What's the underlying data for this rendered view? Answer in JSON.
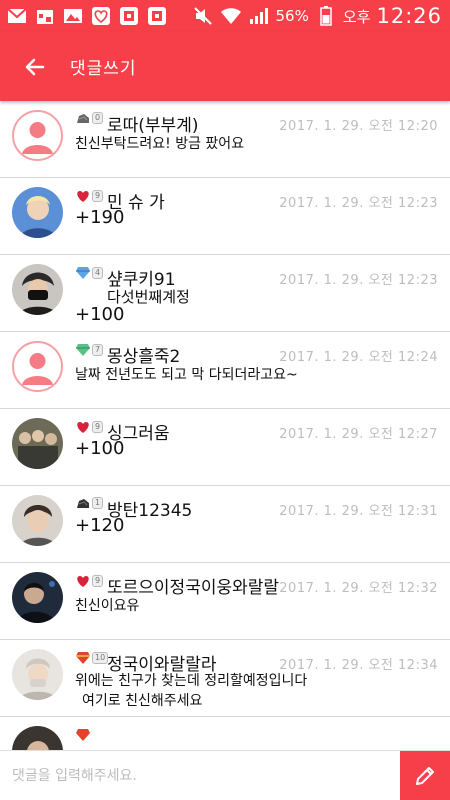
{
  "status_bar": {
    "battery": "56%",
    "ampm": "오후",
    "time": "12:26"
  },
  "header": {
    "title": "댓글쓰기"
  },
  "colors": {
    "accent": "#f63f48",
    "divider": "#d6d6d6",
    "date_text": "#bdbdbd"
  },
  "comments": [
    {
      "name": "로따(부부계)",
      "level": "0",
      "badge_icon": "rock-badge-icon",
      "avatar": "default",
      "date": "2017. 1. 29. 오전 12:20",
      "body": "친신부탁드려요! 방금 팠어요"
    },
    {
      "name": "민 슈 가",
      "level": "9",
      "badge_icon": "heart-badge-icon",
      "avatar": "photo",
      "date": "2017. 1. 29. 오전 12:23",
      "body": "+190"
    },
    {
      "name": "샾쿠키91",
      "level": "4",
      "badge_icon": "gem-badge-icon",
      "avatar": "photo",
      "date": "2017. 1. 29. 오전 12:23",
      "body": "다섯번째계정",
      "body2": "+100"
    },
    {
      "name": "몽상흘죽2",
      "level": "7",
      "badge_icon": "gem-badge-icon",
      "avatar": "default",
      "date": "2017. 1. 29. 오전 12:24",
      "body": "날짜 전년도도 되고 막 다되더라고요~"
    },
    {
      "name": "싱그러움",
      "level": "9",
      "badge_icon": "heart-badge-icon",
      "avatar": "photo",
      "date": "2017. 1. 29. 오전 12:27",
      "body": "+100"
    },
    {
      "name": "방탄12345",
      "level": "1",
      "badge_icon": "rock-badge-icon",
      "avatar": "photo",
      "date": "2017. 1. 29. 오전 12:31",
      "body": "+120"
    },
    {
      "name": "또르으이정국이웅와랄랄",
      "level": "9",
      "badge_icon": "heart-badge-icon",
      "avatar": "photo",
      "date": "2017. 1. 29. 오전 12:32",
      "body": "친신이요유"
    },
    {
      "name": "정국이와랄랄라",
      "level": "10",
      "badge_icon": "jewel-badge-icon",
      "avatar": "photo",
      "date": "2017. 1. 29. 오전 12:34",
      "body": "위에는 친구가 찾는데 정리할예정입니다",
      "body2": "여기로 친신해주세요"
    }
  ],
  "input": {
    "placeholder": "댓글을 입력해주세요."
  }
}
